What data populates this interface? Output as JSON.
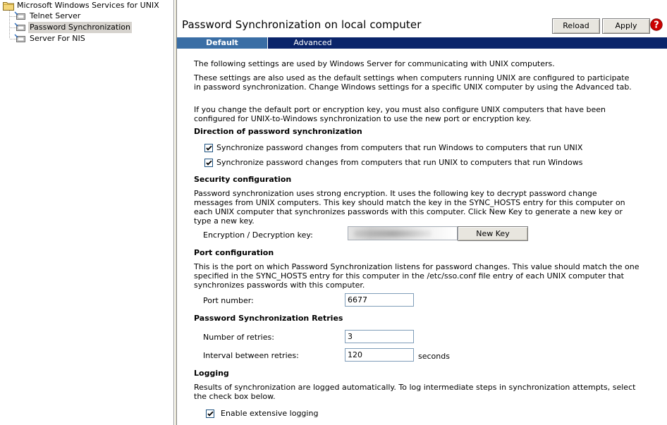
{
  "tree": {
    "root": "Microsoft Windows Services for UNIX",
    "items": [
      {
        "label": "Telnet Server"
      },
      {
        "label": "Password Synchronization",
        "selected": true
      },
      {
        "label": "Server For NIS"
      }
    ]
  },
  "header": {
    "title": "Password Synchronization on local computer",
    "reload_label": "Reload",
    "apply_label": "Apply",
    "help_icon": "help-icon"
  },
  "tabs": [
    {
      "label": "Default",
      "active": true
    },
    {
      "label": "Advanced",
      "active": false
    }
  ],
  "intro": {
    "p1": "The following settings are used by Windows Server for communicating with UNIX computers.",
    "p2": "These settings are also used as the default settings when computers running UNIX are configured to participate in password synchronization. Change Windows settings for a specific UNIX computer by using the Advanced tab.",
    "p3": "If you change the default port or encryption key, you must also configure UNIX computers that have been configured for UNIX-to-Windows synchronization to use the new port or encryption key."
  },
  "direction": {
    "heading": "Direction of password synchronization",
    "opt1": "Synchronize password changes from computers that run Windows to computers that run UNIX",
    "opt2": "Synchronize password changes from computers that run UNIX to computers that run Windows",
    "opt1_checked": true,
    "opt2_checked": true
  },
  "security": {
    "heading": "Security configuration",
    "text": "Password synchronization uses strong encryption. It uses the following key to decrypt password change messages from UNIX computers. This key should match the key in the SYNC_HOSTS entry for this computer on each UNIX computer that synchronizes passwords with this computer. Click New Key to generate a new key or type a new key.",
    "key_label": "Encryption / Decryption key:",
    "new_key_label": "New Key"
  },
  "port": {
    "heading": "Port configuration",
    "text": "This is the port on which Password Synchronization listens for password changes. This value should match the one specified in the SYNC_HOSTS entry for this computer in the /etc/sso.conf file entry of each UNIX computer that synchronizes passwords with this computer.",
    "label": "Port number:",
    "value": "6677"
  },
  "retries": {
    "heading": "Password Synchronization Retries",
    "count_label": "Number of retries:",
    "count_value": "3",
    "interval_label": "Interval between retries:",
    "interval_value": "120",
    "interval_unit": "seconds"
  },
  "logging": {
    "heading": "Logging",
    "text": "Results of synchronization are logged automatically. To log intermediate steps in synchronization attempts, select the check box below.",
    "option": "Enable extensive logging",
    "option_checked": true
  },
  "colors": {
    "tab_bar": "#0a246a",
    "tab_active": "#3a6ea5",
    "help_icon": "#cc0000"
  }
}
